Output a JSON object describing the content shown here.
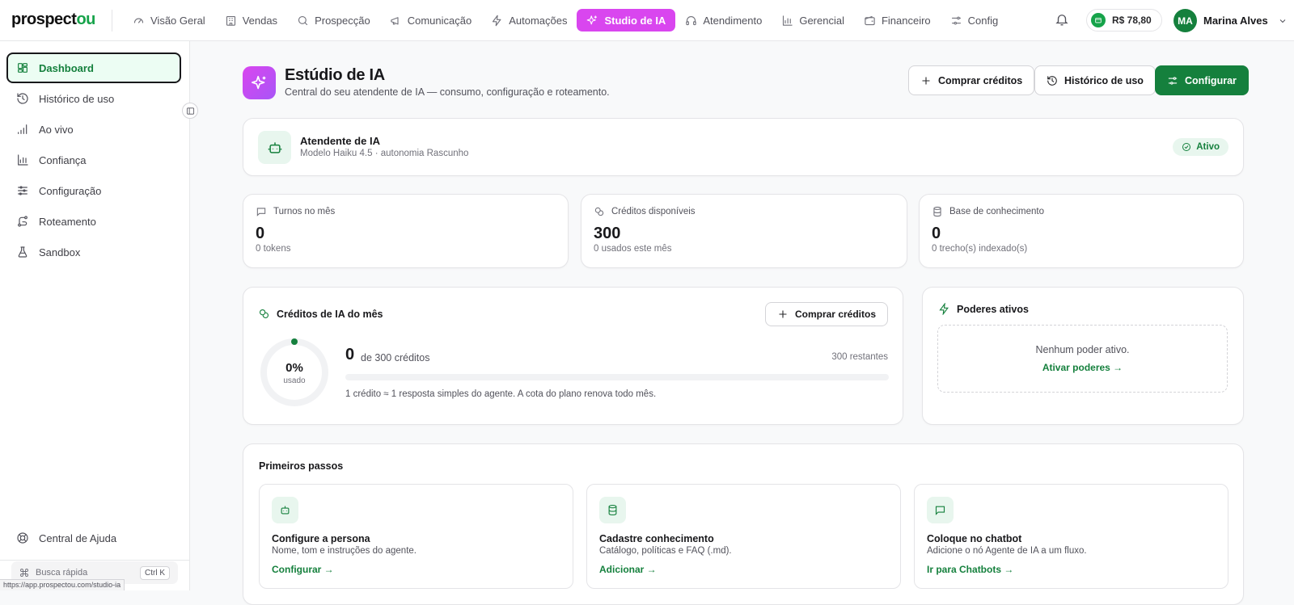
{
  "brand": {
    "logo_main": "prospect",
    "logo_accent": "ou"
  },
  "nav": [
    {
      "label": "Visão Geral",
      "icon": "gauge-icon"
    },
    {
      "label": "Vendas",
      "icon": "building-icon"
    },
    {
      "label": "Prospecção",
      "icon": "search-icon"
    },
    {
      "label": "Comunicação",
      "icon": "megaphone-icon"
    },
    {
      "label": "Automações",
      "icon": "zap-icon"
    },
    {
      "label": "Studio de IA",
      "icon": "sparkles-icon",
      "active": true
    },
    {
      "label": "Atendimento",
      "icon": "headphones-icon"
    },
    {
      "label": "Gerencial",
      "icon": "bar-chart-icon"
    },
    {
      "label": "Financeiro",
      "icon": "wallet-icon"
    },
    {
      "label": "Config",
      "icon": "sliders-icon"
    }
  ],
  "header_right": {
    "balance": "R$ 78,80",
    "user_initials": "MA",
    "user_name": "Marina Alves"
  },
  "sidebar": {
    "items": [
      {
        "label": "Dashboard",
        "icon": "grid-icon",
        "active": true
      },
      {
        "label": "Histórico de uso",
        "icon": "history-icon"
      },
      {
        "label": "Ao vivo",
        "icon": "signal-icon"
      },
      {
        "label": "Confiança",
        "icon": "bar-chart-icon"
      },
      {
        "label": "Configuração",
        "icon": "sliders-icon"
      },
      {
        "label": "Roteamento",
        "icon": "route-icon"
      },
      {
        "label": "Sandbox",
        "icon": "flask-icon"
      }
    ],
    "help": "Central de Ajuda",
    "quick_search": "Busca rápida",
    "quick_kbd": "Ctrl K",
    "status_url": "https://app.prospectou.com/studio-ia"
  },
  "page": {
    "title": "Estúdio de IA",
    "subtitle": "Central do seu atendente de IA — consumo, configuração e roteamento.",
    "buy_credits": "Comprar créditos",
    "usage_history": "Histórico de uso",
    "configure": "Configurar"
  },
  "agent": {
    "name": "Atendente de IA",
    "details": "Modelo Haiku 4.5 · autonomia Rascunho",
    "status": "Ativo"
  },
  "stats": [
    {
      "label": "Turnos no mês",
      "value": "0",
      "sub": "0 tokens",
      "icon": "message-icon"
    },
    {
      "label": "Créditos disponíveis",
      "value": "300",
      "sub": "0 usados este mês",
      "icon": "coins-icon"
    },
    {
      "label": "Base de conhecimento",
      "value": "0",
      "sub": "0 trecho(s) indexado(s)",
      "icon": "database-icon"
    }
  ],
  "credits": {
    "title": "Créditos de IA do mês",
    "buy": "Comprar créditos",
    "percent": "0%",
    "percent_label": "usado",
    "used_fraction": 0,
    "used": "0",
    "of_total": "de 300 créditos",
    "remaining": "300 restantes",
    "note": "1 crédito ≈ 1 resposta simples do agente. A cota do plano renova todo mês."
  },
  "powers": {
    "title": "Poderes ativos",
    "empty": "Nenhum poder ativo.",
    "link": "Ativar poderes →"
  },
  "first_steps": {
    "title": "Primeiros passos",
    "steps": [
      {
        "title": "Configure a persona",
        "desc": "Nome, tom e instruções do agente.",
        "link": "Configurar →",
        "icon": "bot-icon"
      },
      {
        "title": "Cadastre conhecimento",
        "desc": "Catálogo, políticas e FAQ (.md).",
        "link": "Adicionar →",
        "icon": "database-icon"
      },
      {
        "title": "Coloque no chatbot",
        "desc": "Adicione o nó Agente de IA a um fluxo.",
        "link": "Ir para Chatbots →",
        "icon": "message-icon"
      }
    ]
  },
  "colors": {
    "brand_green": "#15803d",
    "studio_magenta": "#d946ef",
    "bg": "#f8f9fa"
  }
}
